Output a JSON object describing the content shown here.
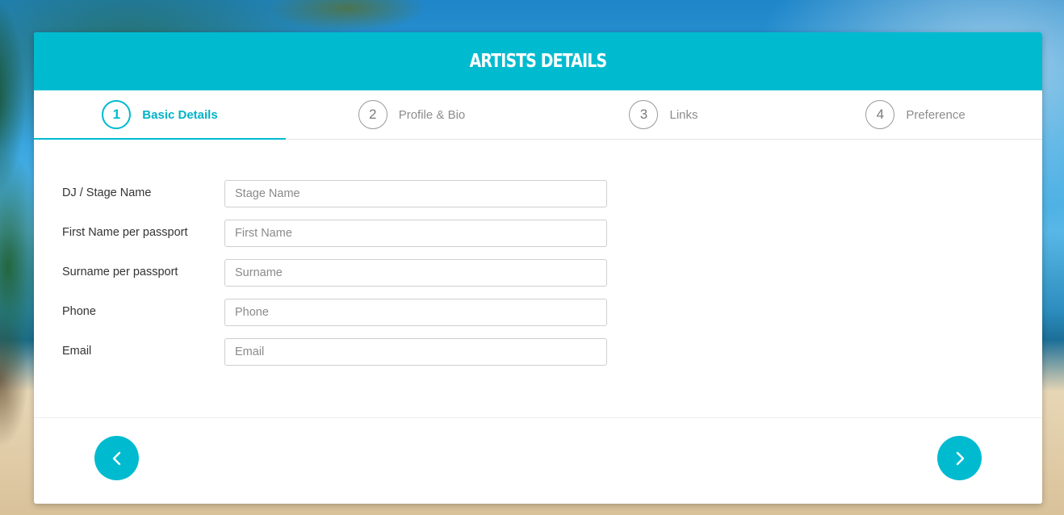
{
  "header": {
    "title": "ARTISTS DETAILS"
  },
  "steps": [
    {
      "number": "1",
      "label": "Basic Details",
      "active": true
    },
    {
      "number": "2",
      "label": "Profile & Bio",
      "active": false
    },
    {
      "number": "3",
      "label": "Links",
      "active": false
    },
    {
      "number": "4",
      "label": "Preference",
      "active": false
    }
  ],
  "form": {
    "fields": [
      {
        "label": "DJ / Stage Name",
        "placeholder": "Stage Name",
        "value": ""
      },
      {
        "label": "First Name per passport",
        "placeholder": "First Name",
        "value": ""
      },
      {
        "label": "Surname per passport",
        "placeholder": "Surname",
        "value": ""
      },
      {
        "label": "Phone",
        "placeholder": "Phone",
        "value": ""
      },
      {
        "label": "Email",
        "placeholder": "Email",
        "value": ""
      }
    ]
  },
  "footer": {
    "prev_icon": "chevron-left-icon",
    "next_icon": "chevron-right-icon"
  },
  "colors": {
    "accent": "#00bbd0"
  }
}
